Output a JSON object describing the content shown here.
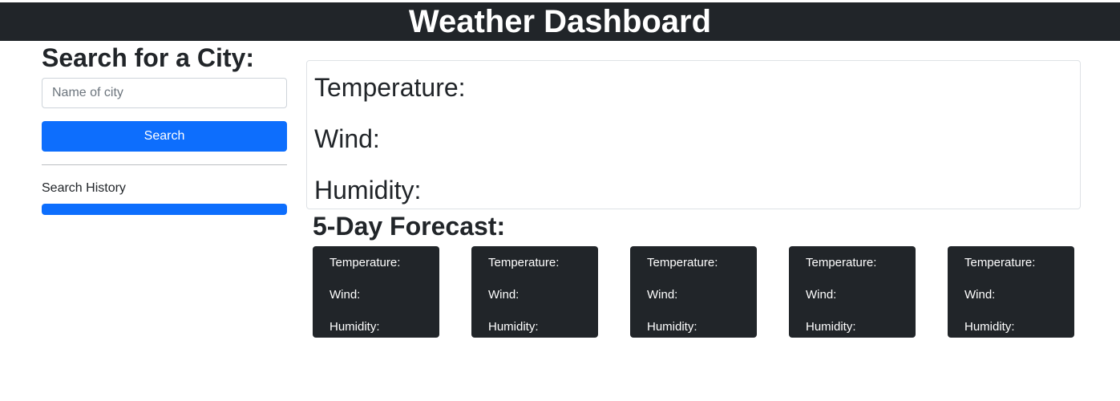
{
  "header": {
    "title": "Weather Dashboard"
  },
  "search": {
    "heading": "Search for a City:",
    "placeholder": "Name of city",
    "value": "",
    "button_label": "Search",
    "history_label": "Search History"
  },
  "current": {
    "temperature_label": "Temperature:",
    "wind_label": "Wind:",
    "humidity_label": "Humidity:"
  },
  "forecast": {
    "heading": "5-Day Forecast:",
    "cards": [
      {
        "temperature_label": "Temperature:",
        "wind_label": "Wind:",
        "humidity_label": "Humidity:"
      },
      {
        "temperature_label": "Temperature:",
        "wind_label": "Wind:",
        "humidity_label": "Humidity:"
      },
      {
        "temperature_label": "Temperature:",
        "wind_label": "Wind:",
        "humidity_label": "Humidity:"
      },
      {
        "temperature_label": "Temperature:",
        "wind_label": "Wind:",
        "humidity_label": "Humidity:"
      },
      {
        "temperature_label": "Temperature:",
        "wind_label": "Wind:",
        "humidity_label": "Humidity:"
      }
    ]
  },
  "colors": {
    "header_bg": "#212529",
    "accent": "#0d6efd",
    "card_dark": "#212529",
    "border": "#dee2e6"
  }
}
